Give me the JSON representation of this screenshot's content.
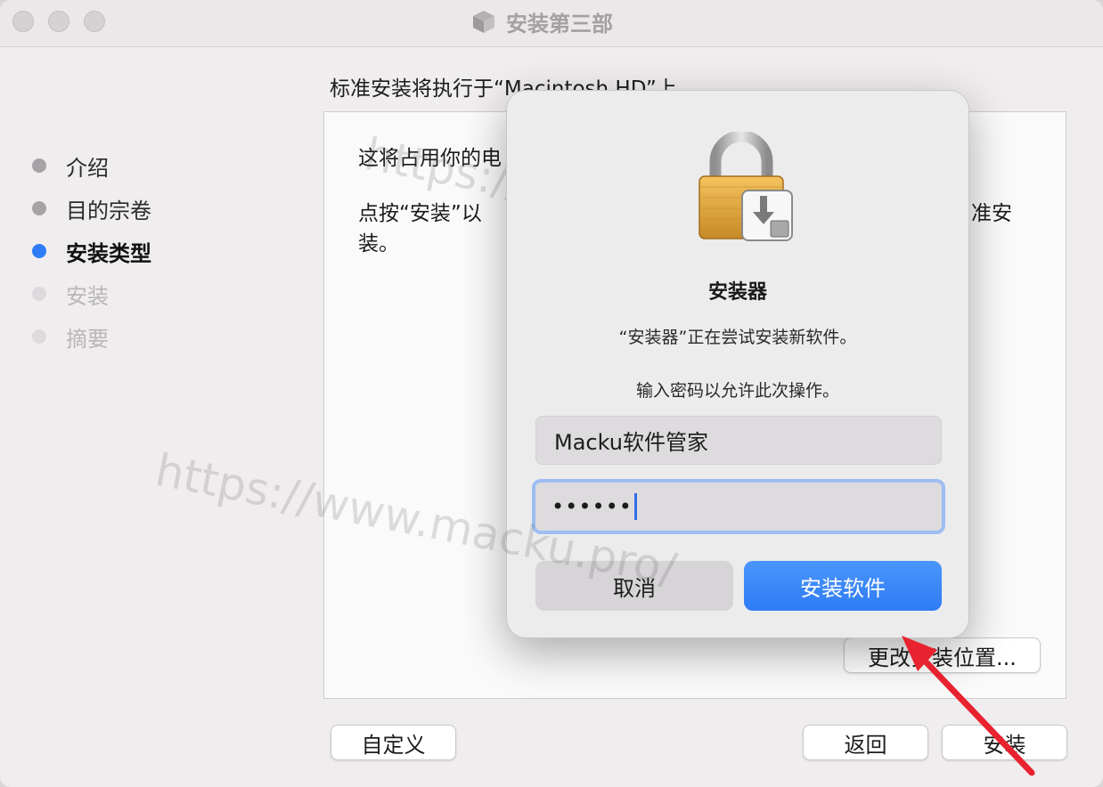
{
  "window": {
    "title": "安装第三部"
  },
  "sidebar": {
    "steps": [
      {
        "label": "介绍",
        "state": "done"
      },
      {
        "label": "目的宗卷",
        "state": "done"
      },
      {
        "label": "安装类型",
        "state": "active"
      },
      {
        "label": "安装",
        "state": "pending"
      },
      {
        "label": "摘要",
        "state": "pending"
      }
    ]
  },
  "main": {
    "header": "标准安装将执行于“Macintosh HD”上",
    "line1": "这将占用你的电",
    "line2": "点按“安装”以",
    "line2_tail": "准安",
    "line3": "装。",
    "change_location_button": "更改安装位置...",
    "customize_button": "自定义",
    "back_button": "返回",
    "install_button": "安装"
  },
  "dialog": {
    "icon": "lock-icon",
    "title": "安装器",
    "message": "“安装器”正在尝试安装新软件。",
    "prompt": "输入密码以允许此次操作。",
    "username_value": "Macku软件管家",
    "password_value": "••••••",
    "cancel_button": "取消",
    "confirm_button": "安装软件"
  },
  "watermark": {
    "text": "https://www.macku.pro/"
  },
  "colors": {
    "accent": "#2f7cf6",
    "arrow": "#e8232f"
  }
}
